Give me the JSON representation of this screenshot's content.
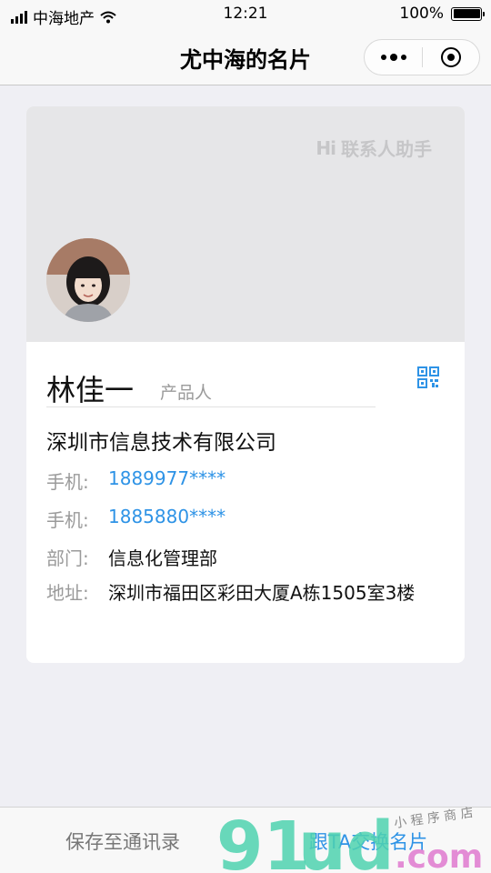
{
  "status_bar": {
    "carrier": "中海地产",
    "time": "12:21",
    "battery": "100%"
  },
  "nav": {
    "title": "尤中海的名片"
  },
  "card": {
    "watermark_text": "联系人助手",
    "watermark_logo": "Hi",
    "name": "林佳一",
    "job_title": "产品人",
    "company": "深圳市信息技术有限公司",
    "rows": [
      {
        "label": "手机:",
        "value": "1889977****"
      },
      {
        "label": "手机:",
        "value": "1885880****"
      },
      {
        "label": "部门:",
        "value": "信息化管理部"
      },
      {
        "label": "地址:",
        "value": "深圳市福田区彩田大厦A栋1505室3楼"
      }
    ]
  },
  "bottom_bar": {
    "save_label": "保存至通讯录",
    "exchange_label": "跟TA交换名片"
  },
  "overlay_watermark": {
    "brand": "91ud.com",
    "tagline": "小程序商店"
  },
  "colors": {
    "accent": "#2e93e6",
    "background": "#efeff4",
    "card_banner": "#e6e6e8",
    "muted_text": "#9a9a9a"
  }
}
